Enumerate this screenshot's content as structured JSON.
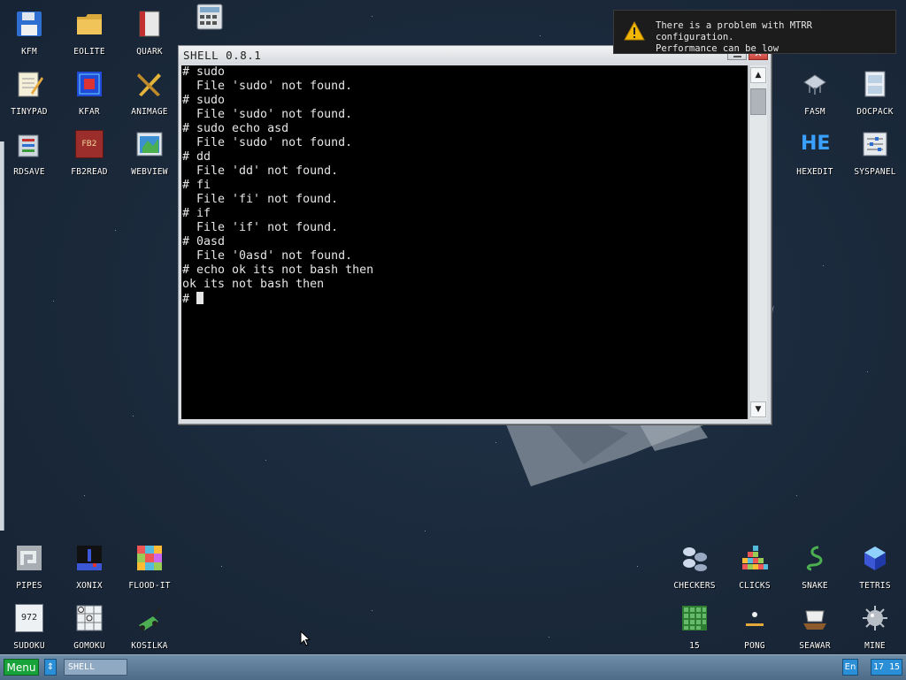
{
  "desktop": {
    "icons_top_left": [
      "KFM",
      "EOLITE",
      "QUARK",
      "TINYPAD",
      "KFAR",
      "ANIMAGE",
      "RDSAVE",
      "FB2READ",
      "WEBVIEW"
    ],
    "icons_top_right": [
      "FASM",
      "DOCPACK",
      "HEXEDIT",
      "SYSPANEL"
    ],
    "icons_bottom_left": [
      "PIPES",
      "XONIX",
      "FLOOD-IT",
      "SUDOKU",
      "GOMOKU",
      "KOSILKA"
    ],
    "icons_bottom_right": [
      "CHECKERS",
      "CLICKS",
      "SNAKE",
      "TETRIS",
      "15",
      "PONG",
      "SEAWAR",
      "MINE"
    ],
    "fb2_badge": "FB2",
    "hexedit_badge": "HE",
    "sudoku_digits": "972"
  },
  "window": {
    "title": "SHELL 0.8.1",
    "close_glyph": "✕",
    "terminal_lines": [
      "# sudo",
      "  File 'sudo' not found.",
      "# sudo",
      "  File 'sudo' not found.",
      "# sudo echo asd",
      "  File 'sudo' not found.",
      "# dd",
      "  File 'dd' not found.",
      "# fi",
      "  File 'fi' not found.",
      "# if",
      "  File 'if' not found.",
      "# 0asd",
      "  File '0asd' not found.",
      "# echo ok its not bash then",
      "ok its not bash then"
    ],
    "prompt": "# "
  },
  "notification": {
    "line1": "There is a problem with MTRR configuration.",
    "line2": "Performance can be low"
  },
  "taskbar": {
    "menu_label": "Menu",
    "switch_glyph": "⇕",
    "task_label": "SHELL",
    "lang": "En",
    "clock": "17 15"
  },
  "colors": {
    "desktop_bg": "#1b2a3c",
    "menu_green": "#17a33a",
    "taskbar_blue": "#4d6a86",
    "accent_blue": "#2a8fd6"
  }
}
